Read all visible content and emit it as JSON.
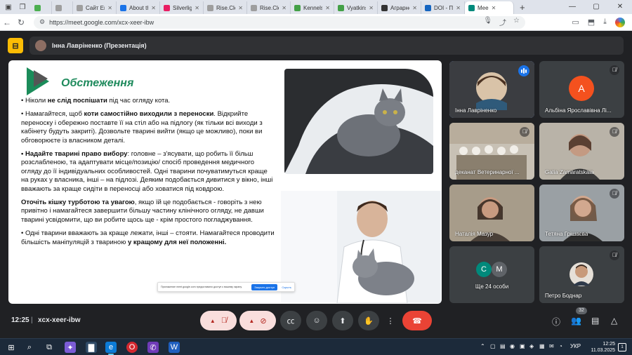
{
  "browser": {
    "tabs": [
      {
        "label": "",
        "color": "#4caf50"
      },
      {
        "label": "",
        "color": "#9e9e9e"
      },
      {
        "label": "Сайт Eral",
        "color": "#9e9e9e"
      },
      {
        "label": "About th",
        "color": "#1a73e8"
      },
      {
        "label": "Silverligh",
        "color": "#e91e63"
      },
      {
        "label": "Rise.Clen",
        "color": "#9e9e9e"
      },
      {
        "label": "Rise.Clen",
        "color": "#9e9e9e"
      },
      {
        "label": "Kennels",
        "color": "#43a047"
      },
      {
        "label": "Vyatkins",
        "color": "#43a047"
      },
      {
        "label": "Аграрне",
        "color": "#333333"
      },
      {
        "label": "DOI - Пе",
        "color": "#1565c0"
      },
      {
        "label": "Mee",
        "color": "#00897b"
      }
    ],
    "url": "https://meet.google.com/xcx-xeer-ibw"
  },
  "presenter_bar": {
    "name": "Інна Лавріненко (Презентація)"
  },
  "slide": {
    "title": "Обстеження",
    "p1_pre": "• Ніколи ",
    "p1_bold": "не слід поспішати",
    "p1_post": " під час огляду кота.",
    "p2_pre": "• Намагайтеся, щоб ",
    "p2_bold": "коти самостійно виходили з переноски",
    "p2_post": ". Відкрийте переноску і обережно поставте її на стіл або на підлогу (як тільки всі виходи з кабінету будуть закриті). Дозвольте тварині вийти (якщо це можливо), поки ви обговорюєте із власником деталі.",
    "p3_bold": "• Надайте тварині право вибору",
    "p3_post": ": головне – з'ясувати, що робить її більш розслабленою, та адаптувати місце/позицію/ спосіб проведення медичного огляду до її індивідуальних особливостей. Одні тварини почуватимуться краще на руках у власника, інші – на підлозі. Деяким подобається дивитися у вікно, інші вважають за краще сидіти в переносці або ховатися під ковдрою.",
    "p4_bold": "Оточіть кішку турботою та увагою",
    "p4_post": ", якщо їй це подобається - говоріть з нею привітно і намагайтеся завершити більшу частину клінічного огляду, не давши тварині  усвідомити, що ви робите щось ще - крім простого погладжування.",
    "p5_pre": "• Одні тварини вважають за краще лежати, інші – стояти. Намагайтеся проводити більшість маніпуляцій з твариною ",
    "p5_bold": "у кращому для неї положенні.",
    "cookie_text": "Приложение meet.google.com предоставило доступ к вашему экрану.",
    "cookie_button": "Закрыть доступ",
    "cookie_more": "Скрыть"
  },
  "participants": [
    {
      "name": "Інна Лавріненко",
      "speaking": true
    },
    {
      "name": "Альбіна Ярославівна Лі...",
      "initial": "A",
      "avatar_color": "#f4511e"
    },
    {
      "name": "деканат Ветеринарної ..."
    },
    {
      "name": "Galia Zamaratskaia"
    },
    {
      "name": "Наталія Мазур"
    },
    {
      "name": "Тетяна Грішаєва"
    },
    {
      "name": "Ще 24 особи",
      "initials": [
        "C",
        "M"
      ],
      "colors": [
        "#00897b",
        "#5f6368"
      ]
    },
    {
      "name": "Петро Боднар"
    }
  ],
  "bottom": {
    "time": "12:25",
    "separator": "|",
    "meeting_code": "xcx-xeer-ibw",
    "people_count": "32"
  },
  "taskbar": {
    "language": "УКР",
    "time": "12:25",
    "date": "11.03.2025",
    "notifications": "1"
  }
}
